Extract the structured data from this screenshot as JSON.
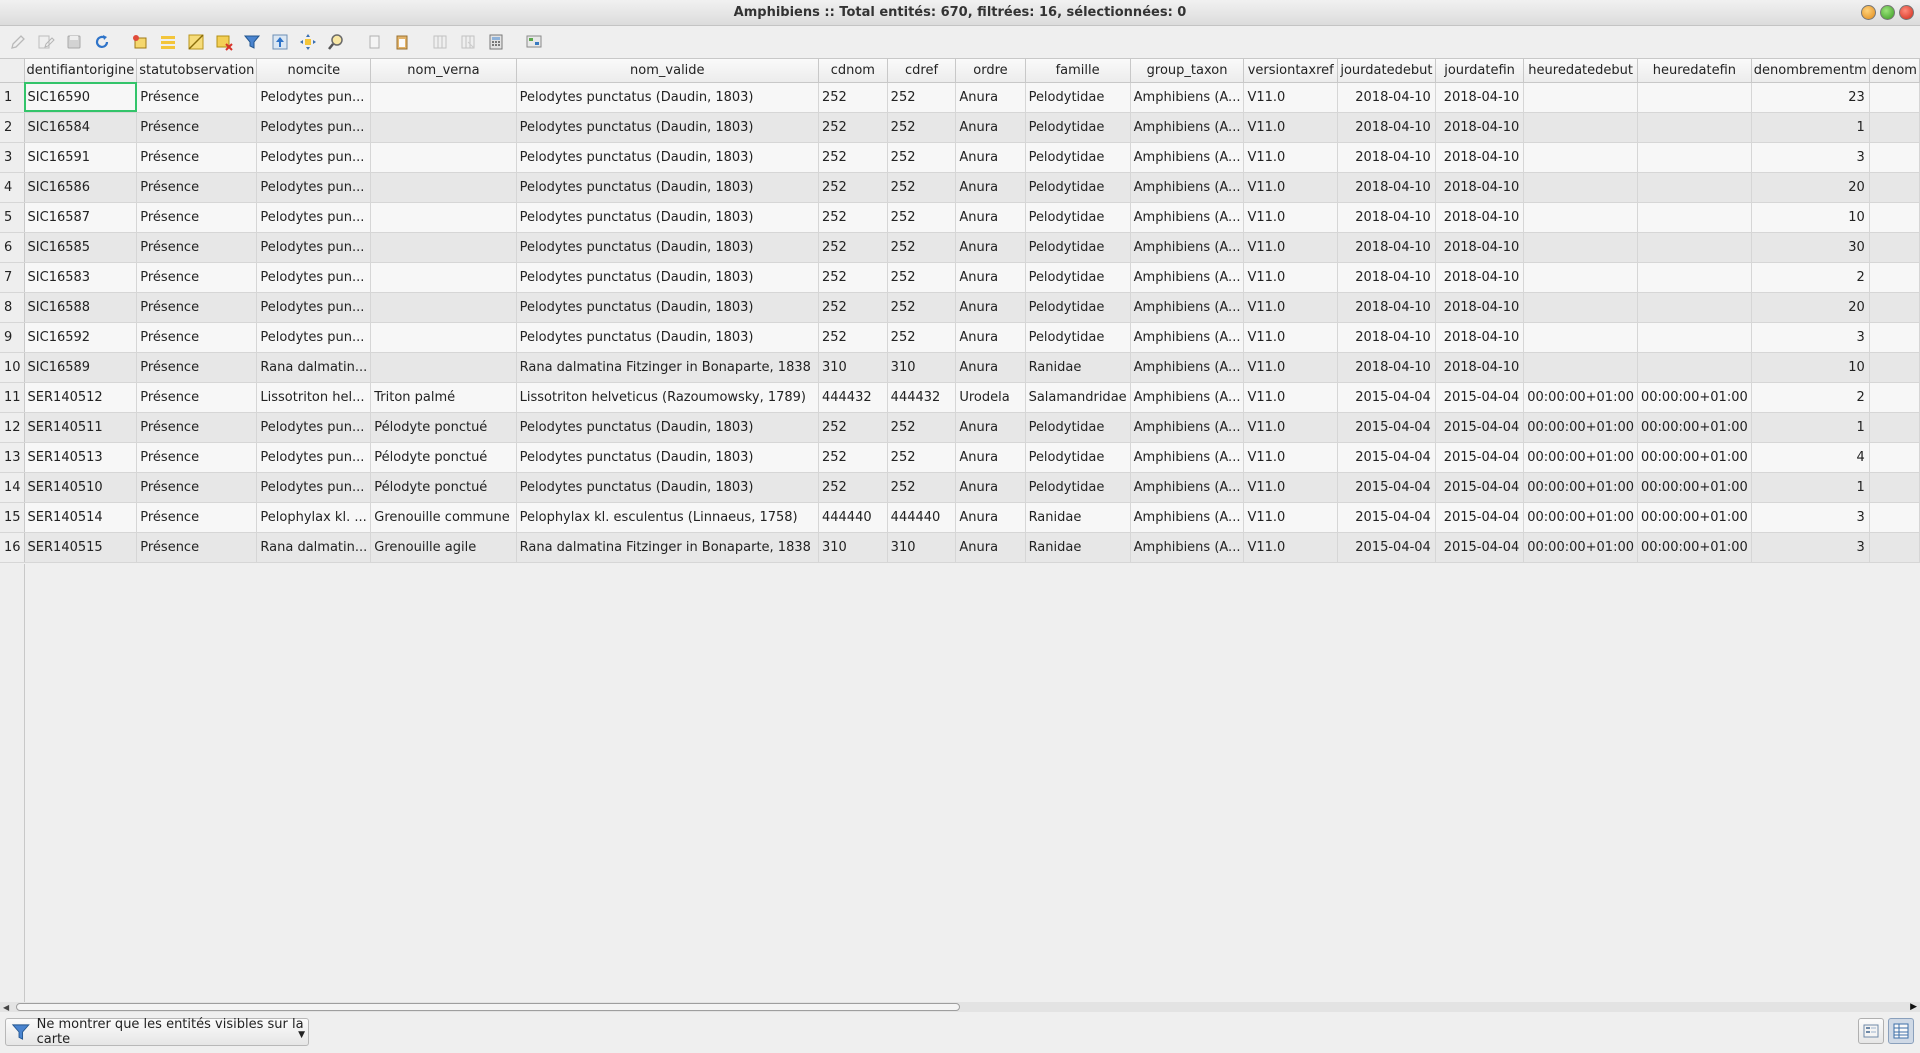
{
  "window": {
    "title": "Amphibiens :: Total entités: 670, filtrées: 16, sélectionnées: 0"
  },
  "toolbar": {
    "icons": [
      "edit-pencil-icon",
      "multi-edit-icon",
      "save-edits-icon",
      "reload-icon",
      "add-feature-icon",
      "delete-feature-icon",
      "select-all-icon",
      "invert-selection-icon",
      "deselect-icon",
      "filter-select-icon",
      "move-top-icon",
      "pan-to-selection-icon",
      "zoom-to-selection-icon",
      "copy-icon",
      "paste-icon",
      "new-field-icon",
      "delete-field-icon",
      "field-calculator-icon",
      "conditional-format-icon"
    ]
  },
  "table": {
    "columns": [
      "dentifiantorigine",
      "statutobservation",
      "nomcite",
      "nom_verna",
      "nom_valide",
      "cdnom",
      "cdref",
      "ordre",
      "famille",
      "group_taxon",
      "versiontaxref",
      "jourdatedebut",
      "jourdatefin",
      "heuredatedebut",
      "heuredatefin",
      "denombrementm",
      "denom"
    ],
    "rows": [
      [
        "1",
        "SIC16590",
        "Présence",
        "Pelodytes pun...",
        "",
        "Pelodytes punctatus (Daudin, 1803)",
        "252",
        "252",
        "Anura",
        "Pelodytidae",
        "Amphibiens (A...",
        "V11.0",
        "2018-04-10",
        "2018-04-10",
        "",
        "",
        "23"
      ],
      [
        "2",
        "SIC16584",
        "Présence",
        "Pelodytes pun...",
        "",
        "Pelodytes punctatus (Daudin, 1803)",
        "252",
        "252",
        "Anura",
        "Pelodytidae",
        "Amphibiens (A...",
        "V11.0",
        "2018-04-10",
        "2018-04-10",
        "",
        "",
        "1"
      ],
      [
        "3",
        "SIC16591",
        "Présence",
        "Pelodytes pun...",
        "",
        "Pelodytes punctatus (Daudin, 1803)",
        "252",
        "252",
        "Anura",
        "Pelodytidae",
        "Amphibiens (A...",
        "V11.0",
        "2018-04-10",
        "2018-04-10",
        "",
        "",
        "3"
      ],
      [
        "4",
        "SIC16586",
        "Présence",
        "Pelodytes pun...",
        "",
        "Pelodytes punctatus (Daudin, 1803)",
        "252",
        "252",
        "Anura",
        "Pelodytidae",
        "Amphibiens (A...",
        "V11.0",
        "2018-04-10",
        "2018-04-10",
        "",
        "",
        "20"
      ],
      [
        "5",
        "SIC16587",
        "Présence",
        "Pelodytes pun...",
        "",
        "Pelodytes punctatus (Daudin, 1803)",
        "252",
        "252",
        "Anura",
        "Pelodytidae",
        "Amphibiens (A...",
        "V11.0",
        "2018-04-10",
        "2018-04-10",
        "",
        "",
        "10"
      ],
      [
        "6",
        "SIC16585",
        "Présence",
        "Pelodytes pun...",
        "",
        "Pelodytes punctatus (Daudin, 1803)",
        "252",
        "252",
        "Anura",
        "Pelodytidae",
        "Amphibiens (A...",
        "V11.0",
        "2018-04-10",
        "2018-04-10",
        "",
        "",
        "30"
      ],
      [
        "7",
        "SIC16583",
        "Présence",
        "Pelodytes pun...",
        "",
        "Pelodytes punctatus (Daudin, 1803)",
        "252",
        "252",
        "Anura",
        "Pelodytidae",
        "Amphibiens (A...",
        "V11.0",
        "2018-04-10",
        "2018-04-10",
        "",
        "",
        "2"
      ],
      [
        "8",
        "SIC16588",
        "Présence",
        "Pelodytes pun...",
        "",
        "Pelodytes punctatus (Daudin, 1803)",
        "252",
        "252",
        "Anura",
        "Pelodytidae",
        "Amphibiens (A...",
        "V11.0",
        "2018-04-10",
        "2018-04-10",
        "",
        "",
        "20"
      ],
      [
        "9",
        "SIC16592",
        "Présence",
        "Pelodytes pun...",
        "",
        "Pelodytes punctatus (Daudin, 1803)",
        "252",
        "252",
        "Anura",
        "Pelodytidae",
        "Amphibiens (A...",
        "V11.0",
        "2018-04-10",
        "2018-04-10",
        "",
        "",
        "3"
      ],
      [
        "10",
        "SIC16589",
        "Présence",
        "Rana dalmatin...",
        "",
        "Rana dalmatina Fitzinger in Bonaparte, 1838",
        "310",
        "310",
        "Anura",
        "Ranidae",
        "Amphibiens (A...",
        "V11.0",
        "2018-04-10",
        "2018-04-10",
        "",
        "",
        "10"
      ],
      [
        "11",
        "SER140512",
        "Présence",
        "Lissotriton hel...",
        "Triton palmé",
        "Lissotriton helveticus (Razoumowsky, 1789)",
        "444432",
        "444432",
        "Urodela",
        "Salamandridae",
        "Amphibiens (A...",
        "V11.0",
        "2015-04-04",
        "2015-04-04",
        "00:00:00+01:00",
        "00:00:00+01:00",
        "2"
      ],
      [
        "12",
        "SER140511",
        "Présence",
        "Pelodytes pun...",
        "Pélodyte ponctué",
        "Pelodytes punctatus (Daudin, 1803)",
        "252",
        "252",
        "Anura",
        "Pelodytidae",
        "Amphibiens (A...",
        "V11.0",
        "2015-04-04",
        "2015-04-04",
        "00:00:00+01:00",
        "00:00:00+01:00",
        "1"
      ],
      [
        "13",
        "SER140513",
        "Présence",
        "Pelodytes pun...",
        "Pélodyte ponctué",
        "Pelodytes punctatus (Daudin, 1803)",
        "252",
        "252",
        "Anura",
        "Pelodytidae",
        "Amphibiens (A...",
        "V11.0",
        "2015-04-04",
        "2015-04-04",
        "00:00:00+01:00",
        "00:00:00+01:00",
        "4"
      ],
      [
        "14",
        "SER140510",
        "Présence",
        "Pelodytes pun...",
        "Pélodyte ponctué",
        "Pelodytes punctatus (Daudin, 1803)",
        "252",
        "252",
        "Anura",
        "Pelodytidae",
        "Amphibiens (A...",
        "V11.0",
        "2015-04-04",
        "2015-04-04",
        "00:00:00+01:00",
        "00:00:00+01:00",
        "1"
      ],
      [
        "15",
        "SER140514",
        "Présence",
        "Pelophylax kl. ...",
        "Grenouille commune",
        "Pelophylax kl. esculentus (Linnaeus, 1758)",
        "444440",
        "444440",
        "Anura",
        "Ranidae",
        "Amphibiens (A...",
        "V11.0",
        "2015-04-04",
        "2015-04-04",
        "00:00:00+01:00",
        "00:00:00+01:00",
        "3"
      ],
      [
        "16",
        "SER140515",
        "Présence",
        "Rana dalmatin...",
        "Grenouille agile",
        "Rana dalmatina Fitzinger in Bonaparte, 1838",
        "310",
        "310",
        "Anura",
        "Ranidae",
        "Amphibiens (A...",
        "V11.0",
        "2015-04-04",
        "2015-04-04",
        "00:00:00+01:00",
        "00:00:00+01:00",
        "3"
      ]
    ]
  },
  "bottom": {
    "filter_label": "Ne montrer que les entités visibles sur la carte"
  },
  "colors": {
    "current_cell_outline": "#33c46a",
    "row_odd": "#f7f7f7",
    "row_even": "#e7e7e7"
  }
}
